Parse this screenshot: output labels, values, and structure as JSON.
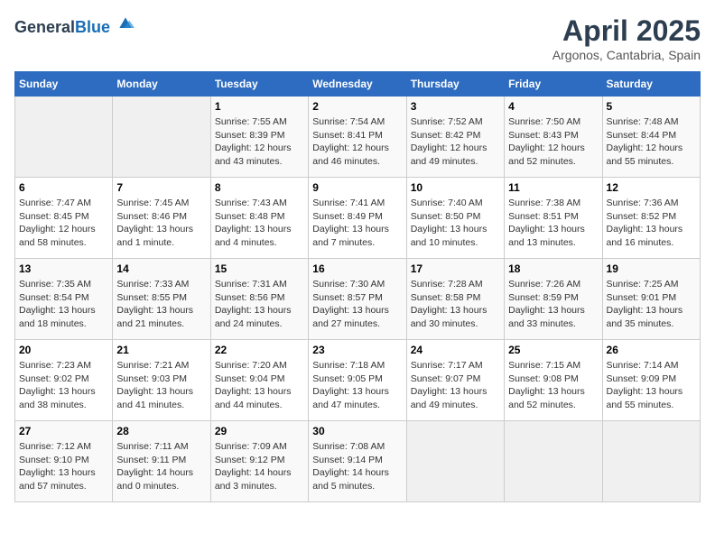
{
  "header": {
    "logo_general": "General",
    "logo_blue": "Blue",
    "month": "April 2025",
    "location": "Argonos, Cantabria, Spain"
  },
  "calendar": {
    "days_of_week": [
      "Sunday",
      "Monday",
      "Tuesday",
      "Wednesday",
      "Thursday",
      "Friday",
      "Saturday"
    ],
    "weeks": [
      [
        {
          "day": "",
          "empty": true
        },
        {
          "day": "",
          "empty": true
        },
        {
          "day": "1",
          "sunrise": "Sunrise: 7:55 AM",
          "sunset": "Sunset: 8:39 PM",
          "daylight": "Daylight: 12 hours and 43 minutes."
        },
        {
          "day": "2",
          "sunrise": "Sunrise: 7:54 AM",
          "sunset": "Sunset: 8:41 PM",
          "daylight": "Daylight: 12 hours and 46 minutes."
        },
        {
          "day": "3",
          "sunrise": "Sunrise: 7:52 AM",
          "sunset": "Sunset: 8:42 PM",
          "daylight": "Daylight: 12 hours and 49 minutes."
        },
        {
          "day": "4",
          "sunrise": "Sunrise: 7:50 AM",
          "sunset": "Sunset: 8:43 PM",
          "daylight": "Daylight: 12 hours and 52 minutes."
        },
        {
          "day": "5",
          "sunrise": "Sunrise: 7:48 AM",
          "sunset": "Sunset: 8:44 PM",
          "daylight": "Daylight: 12 hours and 55 minutes."
        }
      ],
      [
        {
          "day": "6",
          "sunrise": "Sunrise: 7:47 AM",
          "sunset": "Sunset: 8:45 PM",
          "daylight": "Daylight: 12 hours and 58 minutes."
        },
        {
          "day": "7",
          "sunrise": "Sunrise: 7:45 AM",
          "sunset": "Sunset: 8:46 PM",
          "daylight": "Daylight: 13 hours and 1 minute."
        },
        {
          "day": "8",
          "sunrise": "Sunrise: 7:43 AM",
          "sunset": "Sunset: 8:48 PM",
          "daylight": "Daylight: 13 hours and 4 minutes."
        },
        {
          "day": "9",
          "sunrise": "Sunrise: 7:41 AM",
          "sunset": "Sunset: 8:49 PM",
          "daylight": "Daylight: 13 hours and 7 minutes."
        },
        {
          "day": "10",
          "sunrise": "Sunrise: 7:40 AM",
          "sunset": "Sunset: 8:50 PM",
          "daylight": "Daylight: 13 hours and 10 minutes."
        },
        {
          "day": "11",
          "sunrise": "Sunrise: 7:38 AM",
          "sunset": "Sunset: 8:51 PM",
          "daylight": "Daylight: 13 hours and 13 minutes."
        },
        {
          "day": "12",
          "sunrise": "Sunrise: 7:36 AM",
          "sunset": "Sunset: 8:52 PM",
          "daylight": "Daylight: 13 hours and 16 minutes."
        }
      ],
      [
        {
          "day": "13",
          "sunrise": "Sunrise: 7:35 AM",
          "sunset": "Sunset: 8:54 PM",
          "daylight": "Daylight: 13 hours and 18 minutes."
        },
        {
          "day": "14",
          "sunrise": "Sunrise: 7:33 AM",
          "sunset": "Sunset: 8:55 PM",
          "daylight": "Daylight: 13 hours and 21 minutes."
        },
        {
          "day": "15",
          "sunrise": "Sunrise: 7:31 AM",
          "sunset": "Sunset: 8:56 PM",
          "daylight": "Daylight: 13 hours and 24 minutes."
        },
        {
          "day": "16",
          "sunrise": "Sunrise: 7:30 AM",
          "sunset": "Sunset: 8:57 PM",
          "daylight": "Daylight: 13 hours and 27 minutes."
        },
        {
          "day": "17",
          "sunrise": "Sunrise: 7:28 AM",
          "sunset": "Sunset: 8:58 PM",
          "daylight": "Daylight: 13 hours and 30 minutes."
        },
        {
          "day": "18",
          "sunrise": "Sunrise: 7:26 AM",
          "sunset": "Sunset: 8:59 PM",
          "daylight": "Daylight: 13 hours and 33 minutes."
        },
        {
          "day": "19",
          "sunrise": "Sunrise: 7:25 AM",
          "sunset": "Sunset: 9:01 PM",
          "daylight": "Daylight: 13 hours and 35 minutes."
        }
      ],
      [
        {
          "day": "20",
          "sunrise": "Sunrise: 7:23 AM",
          "sunset": "Sunset: 9:02 PM",
          "daylight": "Daylight: 13 hours and 38 minutes."
        },
        {
          "day": "21",
          "sunrise": "Sunrise: 7:21 AM",
          "sunset": "Sunset: 9:03 PM",
          "daylight": "Daylight: 13 hours and 41 minutes."
        },
        {
          "day": "22",
          "sunrise": "Sunrise: 7:20 AM",
          "sunset": "Sunset: 9:04 PM",
          "daylight": "Daylight: 13 hours and 44 minutes."
        },
        {
          "day": "23",
          "sunrise": "Sunrise: 7:18 AM",
          "sunset": "Sunset: 9:05 PM",
          "daylight": "Daylight: 13 hours and 47 minutes."
        },
        {
          "day": "24",
          "sunrise": "Sunrise: 7:17 AM",
          "sunset": "Sunset: 9:07 PM",
          "daylight": "Daylight: 13 hours and 49 minutes."
        },
        {
          "day": "25",
          "sunrise": "Sunrise: 7:15 AM",
          "sunset": "Sunset: 9:08 PM",
          "daylight": "Daylight: 13 hours and 52 minutes."
        },
        {
          "day": "26",
          "sunrise": "Sunrise: 7:14 AM",
          "sunset": "Sunset: 9:09 PM",
          "daylight": "Daylight: 13 hours and 55 minutes."
        }
      ],
      [
        {
          "day": "27",
          "sunrise": "Sunrise: 7:12 AM",
          "sunset": "Sunset: 9:10 PM",
          "daylight": "Daylight: 13 hours and 57 minutes."
        },
        {
          "day": "28",
          "sunrise": "Sunrise: 7:11 AM",
          "sunset": "Sunset: 9:11 PM",
          "daylight": "Daylight: 14 hours and 0 minutes."
        },
        {
          "day": "29",
          "sunrise": "Sunrise: 7:09 AM",
          "sunset": "Sunset: 9:12 PM",
          "daylight": "Daylight: 14 hours and 3 minutes."
        },
        {
          "day": "30",
          "sunrise": "Sunrise: 7:08 AM",
          "sunset": "Sunset: 9:14 PM",
          "daylight": "Daylight: 14 hours and 5 minutes."
        },
        {
          "day": "",
          "empty": true
        },
        {
          "day": "",
          "empty": true
        },
        {
          "day": "",
          "empty": true
        }
      ]
    ]
  }
}
